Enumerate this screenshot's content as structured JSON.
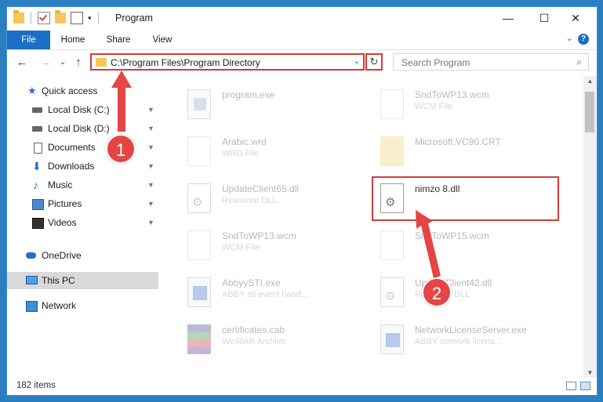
{
  "window": {
    "title": "Program",
    "controls": {
      "minimize": "—",
      "maximize": "☐",
      "close": "✕"
    }
  },
  "ribbon": {
    "tabs": [
      "File",
      "Home",
      "Share",
      "View"
    ],
    "help": "?",
    "collapse_icon": "chevron-down-icon"
  },
  "nav": {
    "back": "←",
    "forward": "→",
    "recent": "⌄",
    "up": "↑",
    "address": "C:\\Program Files\\Program Directory",
    "address_drop": "⌄",
    "refresh": "↻",
    "search_placeholder": "Search Program",
    "search_icon": "⌕"
  },
  "sidebar": {
    "items": [
      {
        "label": "Quick access",
        "icon": "star-icon",
        "pinned": false
      },
      {
        "label": "Local Disk (C:)",
        "icon": "drive-icon",
        "pinned": true
      },
      {
        "label": "Local Disk (D:)",
        "icon": "drive-icon",
        "pinned": true
      },
      {
        "label": "Documents",
        "icon": "document-icon",
        "pinned": true
      },
      {
        "label": "Downloads",
        "icon": "download-icon",
        "pinned": true
      },
      {
        "label": "Music",
        "icon": "music-icon",
        "pinned": true
      },
      {
        "label": "Pictures",
        "icon": "pictures-icon",
        "pinned": true
      },
      {
        "label": "Videos",
        "icon": "videos-icon",
        "pinned": true
      },
      {
        "label": "OneDrive",
        "icon": "cloud-icon",
        "pinned": false
      },
      {
        "label": "This PC",
        "icon": "computer-icon",
        "pinned": false,
        "selected": true
      },
      {
        "label": "Network",
        "icon": "network-icon",
        "pinned": false
      }
    ],
    "pin_glyph": "📌"
  },
  "files": [
    {
      "name": "program.exe",
      "type": "",
      "icon": "setup-icon"
    },
    {
      "name": "SndToWP13.wcm",
      "type": "WCM File",
      "icon": "file-icon"
    },
    {
      "name": "Arabic.wrd",
      "type": "WRD File",
      "icon": "file-icon"
    },
    {
      "name": "Microsoft.VC90.CRT",
      "type": "",
      "icon": "folder-icon"
    },
    {
      "name": "UpdateClient65.dll",
      "type": "Resource DLL",
      "icon": "dll-icon"
    },
    {
      "name": "nimzo 8.dll",
      "type": "",
      "icon": "dll-icon",
      "highlighted": true
    },
    {
      "name": "SndToWP13.wcm",
      "type": "WCM File",
      "icon": "file-icon"
    },
    {
      "name": "SndToWP15.wcm",
      "type": "",
      "icon": "file-icon"
    },
    {
      "name": "AbbyySTI.exe",
      "type": "ABBY sti event hand...",
      "icon": "exe-icon"
    },
    {
      "name": "UpdateClient42.dll",
      "type": "Resource DLL",
      "icon": "dll-icon"
    },
    {
      "name": "certificates.cab",
      "type": "WinRAR Archive",
      "icon": "archive-icon"
    },
    {
      "name": "NetworkLicenseServer.exe",
      "type": "ABBY network licens...",
      "icon": "exe-icon"
    }
  ],
  "status": {
    "item_count": "182 items"
  },
  "annotations": {
    "step1": "1",
    "step2": "2",
    "accent": "#e44545"
  }
}
